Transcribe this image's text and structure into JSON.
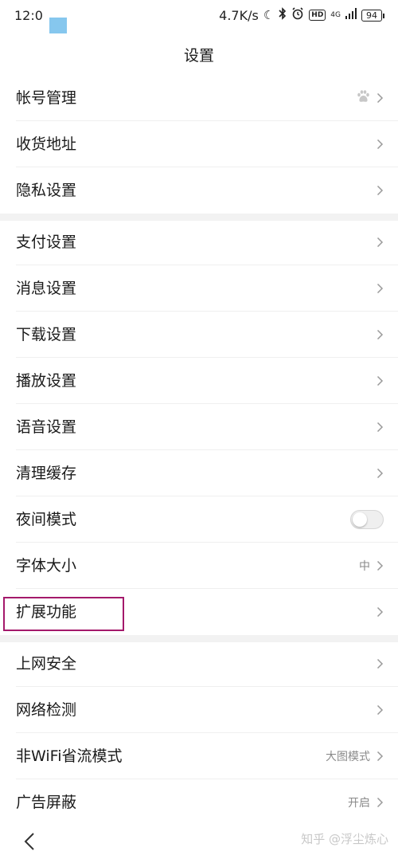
{
  "status_bar": {
    "time": "12:0",
    "network_speed": "4.7K/s",
    "hd_badge": "HD",
    "signal_label": "4G",
    "battery": "94",
    "icons": [
      "moon-icon",
      "bluetooth-icon",
      "alarm-icon",
      "signal-icon",
      "battery-icon"
    ]
  },
  "header": {
    "title": "设置"
  },
  "groups": [
    {
      "items": [
        {
          "label": "帐号管理",
          "value": "",
          "icon": "baidu-paw-icon"
        },
        {
          "label": "收货地址",
          "value": ""
        },
        {
          "label": "隐私设置",
          "value": ""
        }
      ]
    },
    {
      "items": [
        {
          "label": "支付设置",
          "value": ""
        },
        {
          "label": "消息设置",
          "value": ""
        },
        {
          "label": "下载设置",
          "value": ""
        },
        {
          "label": "播放设置",
          "value": ""
        },
        {
          "label": "语音设置",
          "value": ""
        },
        {
          "label": "清理缓存",
          "value": ""
        },
        {
          "label": "夜间模式",
          "toggle": false
        },
        {
          "label": "字体大小",
          "value": "中"
        },
        {
          "label": "扩展功能",
          "value": "",
          "highlighted": true
        }
      ]
    },
    {
      "items": [
        {
          "label": "上网安全",
          "value": ""
        },
        {
          "label": "网络检测",
          "value": ""
        },
        {
          "label": "非WiFi省流模式",
          "value": "大图模式"
        },
        {
          "label": "广告屏蔽",
          "value": "开启"
        }
      ]
    }
  ],
  "bottom_bar": {
    "back_icon": "chevron-left-icon",
    "watermark": "知乎 @浮尘炼心"
  },
  "colors": {
    "highlight_border": "#a4196b",
    "section_gap": "#f2f2f2",
    "status_square": "#86c7ee"
  }
}
